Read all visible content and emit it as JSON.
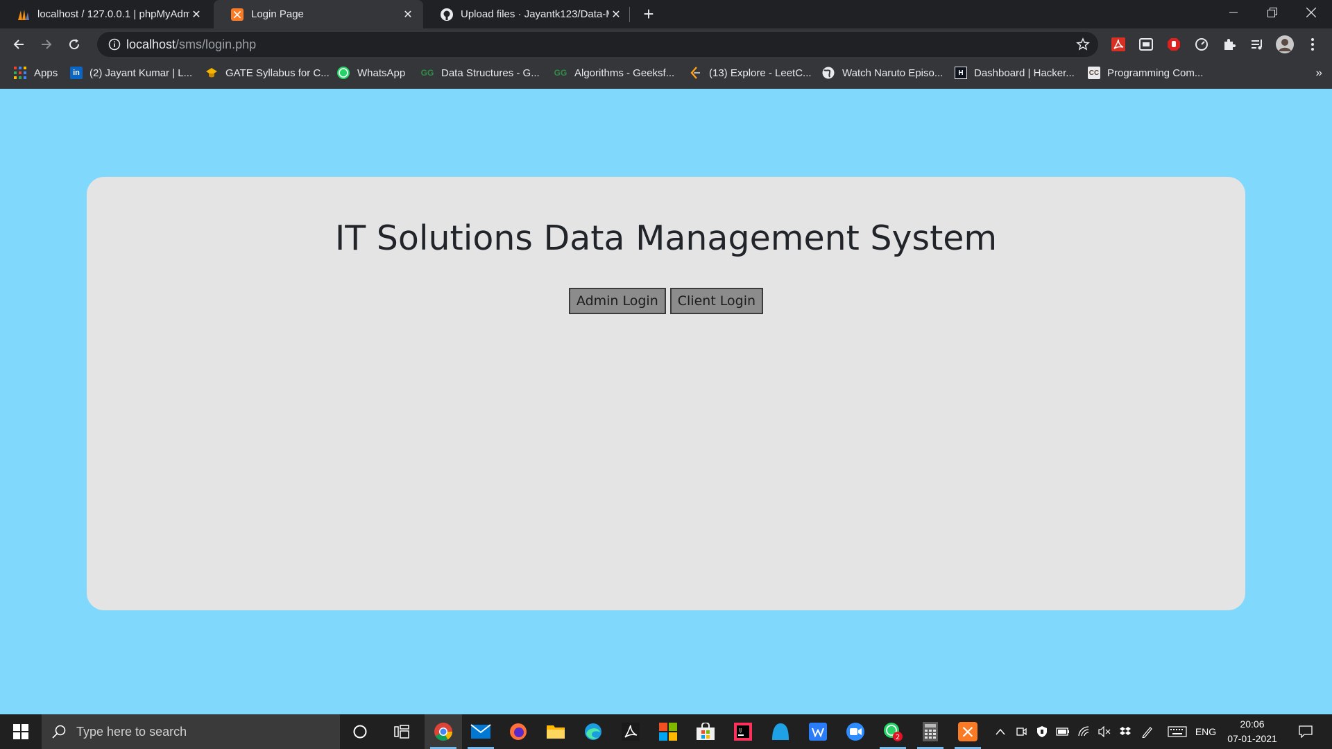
{
  "browser": {
    "tabs": [
      {
        "title": "localhost / 127.0.0.1 | phpMyAdm",
        "icon": "phpmyadmin-icon",
        "active": false
      },
      {
        "title": "Login Page",
        "icon": "xampp-icon",
        "active": true
      },
      {
        "title": "Upload files · Jayantk123/Data-M",
        "icon": "github-icon",
        "active": false
      }
    ],
    "address": {
      "host": "localhost",
      "path": "/sms/login.php"
    },
    "bookmarks": [
      {
        "label": "Apps",
        "icon": "apps-grid-icon"
      },
      {
        "label": "(2) Jayant Kumar | L...",
        "icon": "linkedin-icon"
      },
      {
        "label": "GATE Syllabus for C...",
        "icon": "gate-icon"
      },
      {
        "label": "WhatsApp",
        "icon": "whatsapp-icon"
      },
      {
        "label": "Data Structures - G...",
        "icon": "geeksforgeeks-icon"
      },
      {
        "label": "Algorithms - Geeksf...",
        "icon": "geeksforgeeks-icon"
      },
      {
        "label": "(13) Explore - LeetC...",
        "icon": "leetcode-icon"
      },
      {
        "label": "Watch Naruto Episo...",
        "icon": "globe-icon"
      },
      {
        "label": "Dashboard | Hacker...",
        "icon": "hackerrank-icon"
      },
      {
        "label": "Programming Com...",
        "icon": "codechef-icon"
      }
    ]
  },
  "page": {
    "heading": "IT Solutions Data Management System",
    "admin_button": "Admin Login",
    "client_button": "Client Login"
  },
  "taskbar": {
    "search_placeholder": "Type here to search",
    "language": "ENG",
    "time": "20:06",
    "date": "07-01-2021",
    "whatsapp_badge": "2"
  },
  "colors": {
    "page_background": "#80d8fc",
    "card_background": "#e4e4e4",
    "button_background": "#8c8c8c"
  }
}
